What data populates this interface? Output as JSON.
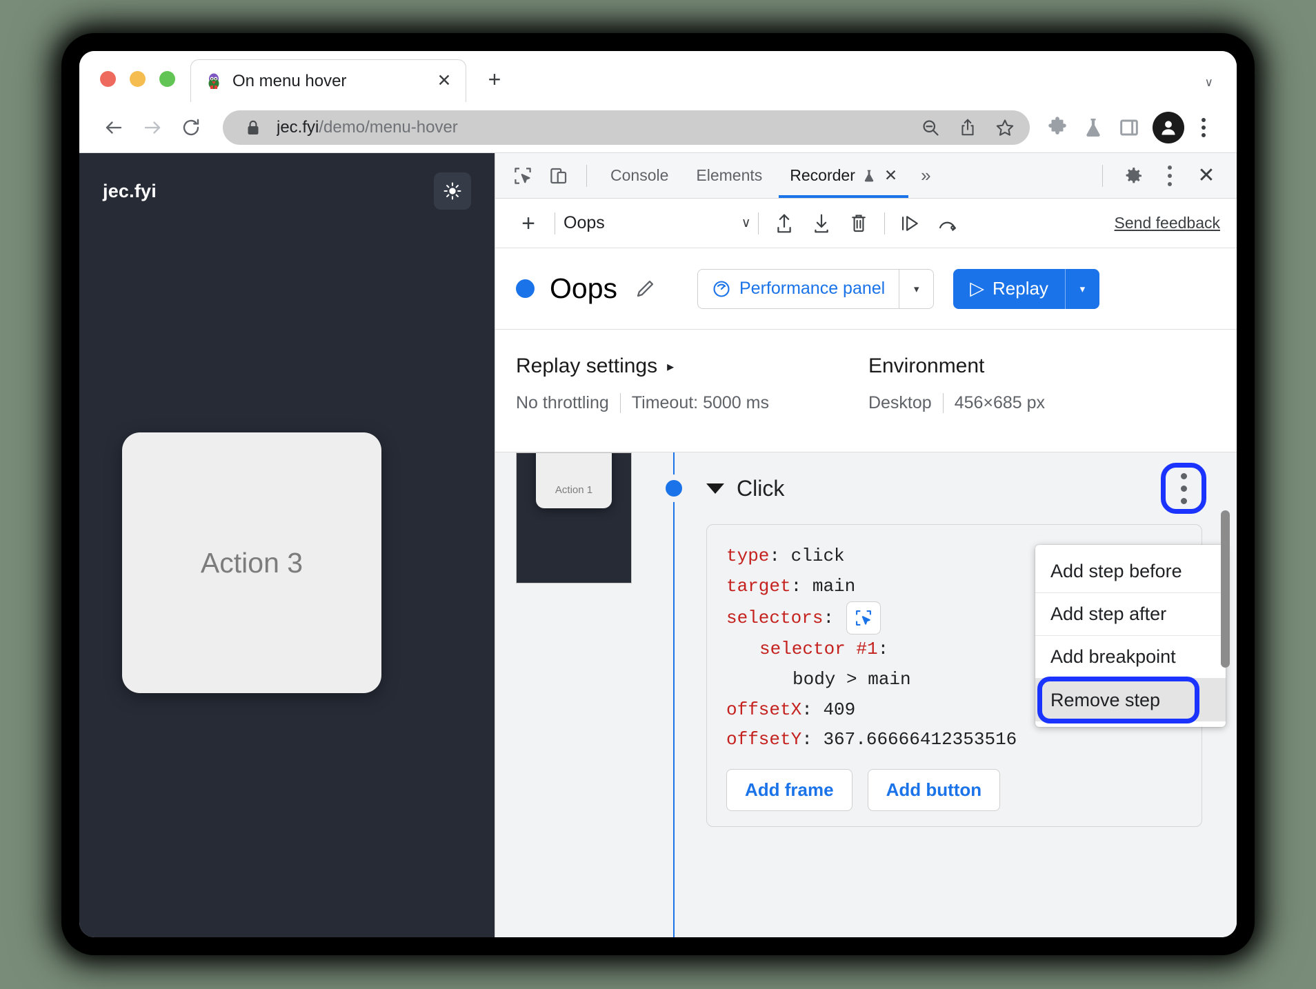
{
  "browser": {
    "traffic_lights": [
      "close",
      "minimize",
      "zoom"
    ],
    "tab": {
      "title": "On menu hover",
      "favicon": "penguin-favicon",
      "close_label": "✕"
    },
    "new_tab_label": "+",
    "window_chevron": "∨",
    "omnibox": {
      "lock_icon": "lock-icon",
      "url_host": "jec.fyi",
      "url_path": "/demo/menu-hover",
      "zoom_out_icon": "zoom-out-icon",
      "share_icon": "share-icon",
      "bookmark_icon": "star-icon"
    },
    "toolbar_icons": [
      "extensions-puzzle-icon",
      "flask-icon",
      "side-panel-icon",
      "profile-avatar",
      "chrome-menu-icon"
    ]
  },
  "page_preview": {
    "brand": "jec.fyi",
    "theme_toggle_icon": "sun-icon",
    "card_label": "Action 3"
  },
  "devtools": {
    "tabbar": {
      "inspect_icon": "inspect-element-icon",
      "device_icon": "device-toolbar-icon",
      "tabs": [
        {
          "label": "Console",
          "active": false,
          "closable": false
        },
        {
          "label": "Elements",
          "active": false,
          "closable": false
        },
        {
          "label": "Recorder",
          "active": true,
          "closable": true,
          "badge_icon": "experiment-flask-icon",
          "close_label": "✕"
        }
      ],
      "more_tabs": "»",
      "settings_icon": "gear-icon",
      "kebab_icon": "more-options-icon",
      "close_icon": "close-devtools-icon",
      "close_label": "✕"
    },
    "recorder_toolbar": {
      "add_label": "+",
      "recording_name": "Oops",
      "caret": "∨",
      "export_icon": "export-icon",
      "import_icon": "import-icon",
      "delete_icon": "trash-icon",
      "step_by_step_icon": "step-over-icon",
      "replay_slow_icon": "replay-speed-icon",
      "send_feedback": "Send feedback"
    },
    "title_row": {
      "status_dot_color": "#1a73e8",
      "name": "Oops",
      "edit_icon": "pencil-icon",
      "performance_button": {
        "icon": "performance-gauge-icon",
        "label": "Performance panel",
        "caret": "▾"
      },
      "replay_button": {
        "icon": "▷",
        "label": "Replay",
        "caret": "▾"
      }
    },
    "settings": {
      "replay": {
        "heading": "Replay settings",
        "caret": "▸",
        "values": [
          "No throttling",
          "Timeout: 5000 ms"
        ]
      },
      "environment": {
        "heading": "Environment",
        "values": [
          "Desktop",
          "456×685 px"
        ]
      }
    },
    "steps": {
      "thumbnail_label": "Action 1",
      "step": {
        "caret": "▾",
        "title": "Click",
        "kebab_icon": "step-more-options-icon",
        "fields": [
          {
            "key": "type",
            "value": "click"
          },
          {
            "key": "target",
            "value": "main"
          }
        ],
        "selectors_key": "selectors",
        "selectors_button_icon": "select-element-icon",
        "selector_1_key": "selector #1",
        "selector_1_value": "body > main",
        "offsetX_key": "offsetX",
        "offsetX_value": "409",
        "offsetY_key": "offsetY",
        "offsetY_value": "367.66666412353516",
        "add_frame": "Add frame",
        "add_button": "Add button"
      },
      "context_menu": [
        {
          "label": "Add step before",
          "highlighted": false
        },
        {
          "label": "Add step after",
          "highlighted": false
        },
        {
          "label": "Add breakpoint",
          "highlighted": false
        },
        {
          "label": "Remove step",
          "highlighted": true
        }
      ]
    }
  },
  "colors": {
    "accent_blue": "#1a73e8",
    "highlight_blue": "#1a33ff",
    "key_red": "#c5221f",
    "page_dark": "#262b36"
  }
}
